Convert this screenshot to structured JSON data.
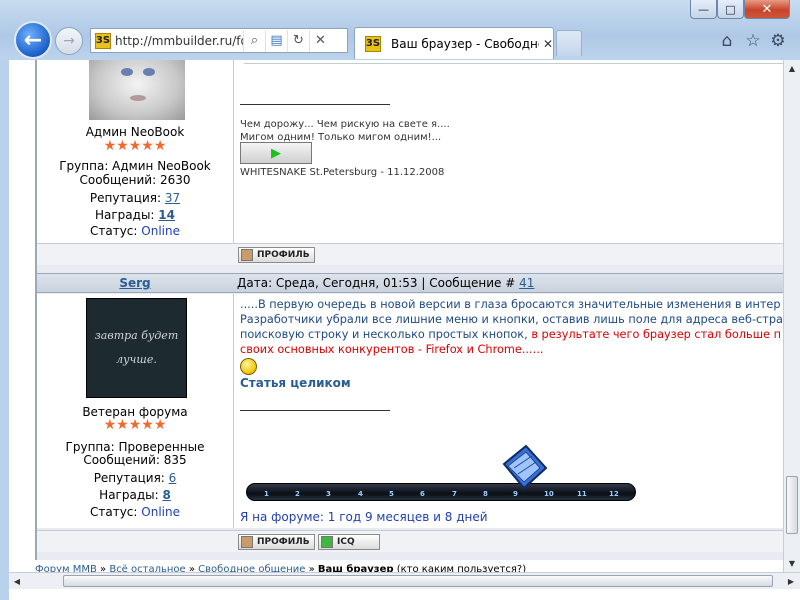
{
  "browser": {
    "url": "http://mmbuilder.ru/fo",
    "tab_title": "Ваш браузер - Свободное о...",
    "favicon_label": "3S",
    "back_icon": "back-arrow-icon",
    "forward_icon": "forward-arrow-icon",
    "close_glyph": "✕",
    "min_glyph": "—",
    "max_glyph": "□"
  },
  "post1": {
    "user_title": "Админ NeoBook",
    "stars": "★★★★★",
    "group": "Группа: Админ NeoBook",
    "messages": "Сообщений: 2630",
    "reputation_label": "Репутация:",
    "reputation": "37",
    "awards_label": "Награды:",
    "awards": "14",
    "status_label": "Статус:",
    "status": "Online",
    "sig_line1": "Чем дорожу... Чем рискую на свете я....",
    "sig_line2": "Мигом одним! Только мигом одним!...",
    "sig_credit": "WHITESNAKE St.Petersburg - 11.12.2008",
    "profile_btn": "ПРОФИЛЬ"
  },
  "post2": {
    "author": "Serg",
    "meta_prefix": "Дата: Среда, Сегодня, 01:53 | Сообщение #",
    "post_number": "41",
    "avatar_text_1": "завтра будет",
    "avatar_text_2": "лучше.",
    "user_title": "Ветеран форума",
    "stars": "★★★★★",
    "group": "Группа: Проверенные",
    "messages": "Сообщений: 835",
    "reputation_label": "Репутация:",
    "reputation": "6",
    "awards_label": "Награды:",
    "awards": "8",
    "status_label": "Статус:",
    "status": "Online",
    "text_line1": ".....В первую очередь в новой версии в глаза бросаются значительные изменения в интер",
    "text_line2": "Разработчики убрали все лишние меню и кнопки, оставив лишь поле для адреса веб-стра",
    "text_line3a": "поисковую строку и несколько простых кнопок, ",
    "text_line3b": "в результате чего браузер стал больше п",
    "text_line4": "своих основных конкурентов - Firefox и Chrome......",
    "full_article": "Статья целиком",
    "timeline_ticks": [
      "1",
      "2",
      "3",
      "4",
      "5",
      "6",
      "7",
      "8",
      "9",
      "10",
      "11",
      "12"
    ],
    "on_forum": "Я на форуме: 1 год 9 месяцев и 8 дней",
    "profile_btn": "ПРОФИЛЬ",
    "icq_btn": "ICQ"
  },
  "breadcrumb": {
    "item1": "Форум MMB",
    "item2": "Всё остальное",
    "item3": "Свободное общение",
    "current": "Ваш браузер",
    "suffix": "(кто каким пользуется?)",
    "sep": " » "
  },
  "colors": {
    "accent": "#2a5d94",
    "stars": "#f06a2e",
    "red": "#dd0000",
    "online": "#1f3fb5"
  }
}
